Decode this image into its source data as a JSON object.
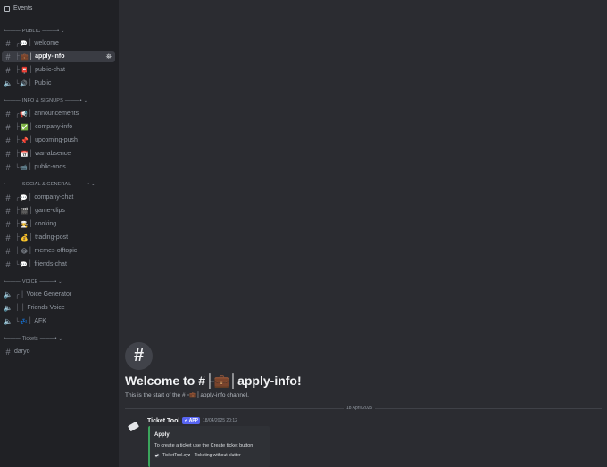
{
  "sidebar": {
    "events_label": "Events",
    "categories": [
      {
        "label": "PUBLIC"
      },
      {
        "label": "INFO & SIGNUPS"
      },
      {
        "label": "SOCIAL & GENERAL"
      },
      {
        "label": "VOICE"
      },
      {
        "label": "Tickets"
      }
    ],
    "category_prefix": "•———",
    "category_suffix": "———•",
    "channels": [
      {
        "tree": "╭",
        "emoji": "💬",
        "label": "welcome"
      },
      {
        "tree": "├",
        "emoji": "💼",
        "label": "apply-info"
      },
      {
        "tree": "├",
        "emoji": "📮",
        "label": "public-chat"
      },
      {
        "tree": "╰",
        "emoji": "🔊",
        "label": "Public"
      },
      {
        "tree": "╭",
        "emoji": "📢",
        "label": "announcements"
      },
      {
        "tree": "├",
        "emoji": "✅",
        "label": "company-info"
      },
      {
        "tree": "├",
        "emoji": "📌",
        "label": "upcoming-push"
      },
      {
        "tree": "├",
        "emoji": "📅",
        "label": "war-absence"
      },
      {
        "tree": "╰",
        "emoji": "📹",
        "label": "public-vods"
      },
      {
        "tree": "╭",
        "emoji": "💬",
        "label": "company-chat"
      },
      {
        "tree": "├",
        "emoji": "🎬",
        "label": "game-clips"
      },
      {
        "tree": "├",
        "emoji": "🧑‍🍳",
        "label": "cooking"
      },
      {
        "tree": "├",
        "emoji": "💰",
        "label": "trading-post"
      },
      {
        "tree": "├",
        "emoji": "😂",
        "label": "memes-offtopic"
      },
      {
        "tree": "╰",
        "emoji": "💬",
        "label": "friends-chat"
      },
      {
        "tree": "╭",
        "emoji": "",
        "label": "Voice Generator"
      },
      {
        "tree": "├",
        "emoji": "",
        "label": "Friends Voice"
      },
      {
        "tree": "╰",
        "emoji": "💤",
        "label": "AFK"
      },
      {
        "tree": "",
        "emoji": "",
        "label": "daryo"
      }
    ]
  },
  "welcome": {
    "title": "Welcome to #├💼│apply-info!",
    "subtitle": "This is the start of the #├💼│apply-info channel."
  },
  "divider_date": "18 April 2025",
  "message": {
    "author": "Ticket Tool",
    "badge": "✔ APP",
    "timestamp": "18/04/2025 20:12",
    "embed": {
      "title": "Apply",
      "description": "To create a ticket use the Create ticket button",
      "footer": "TicketTool.xyz - Ticketing without clutter",
      "accent": "#3ba55c"
    }
  },
  "colors": {
    "sidebar_bg": "#202125",
    "main_bg": "#2b2c31",
    "active_bg": "#3a3c43",
    "brand": "#5865f2"
  }
}
